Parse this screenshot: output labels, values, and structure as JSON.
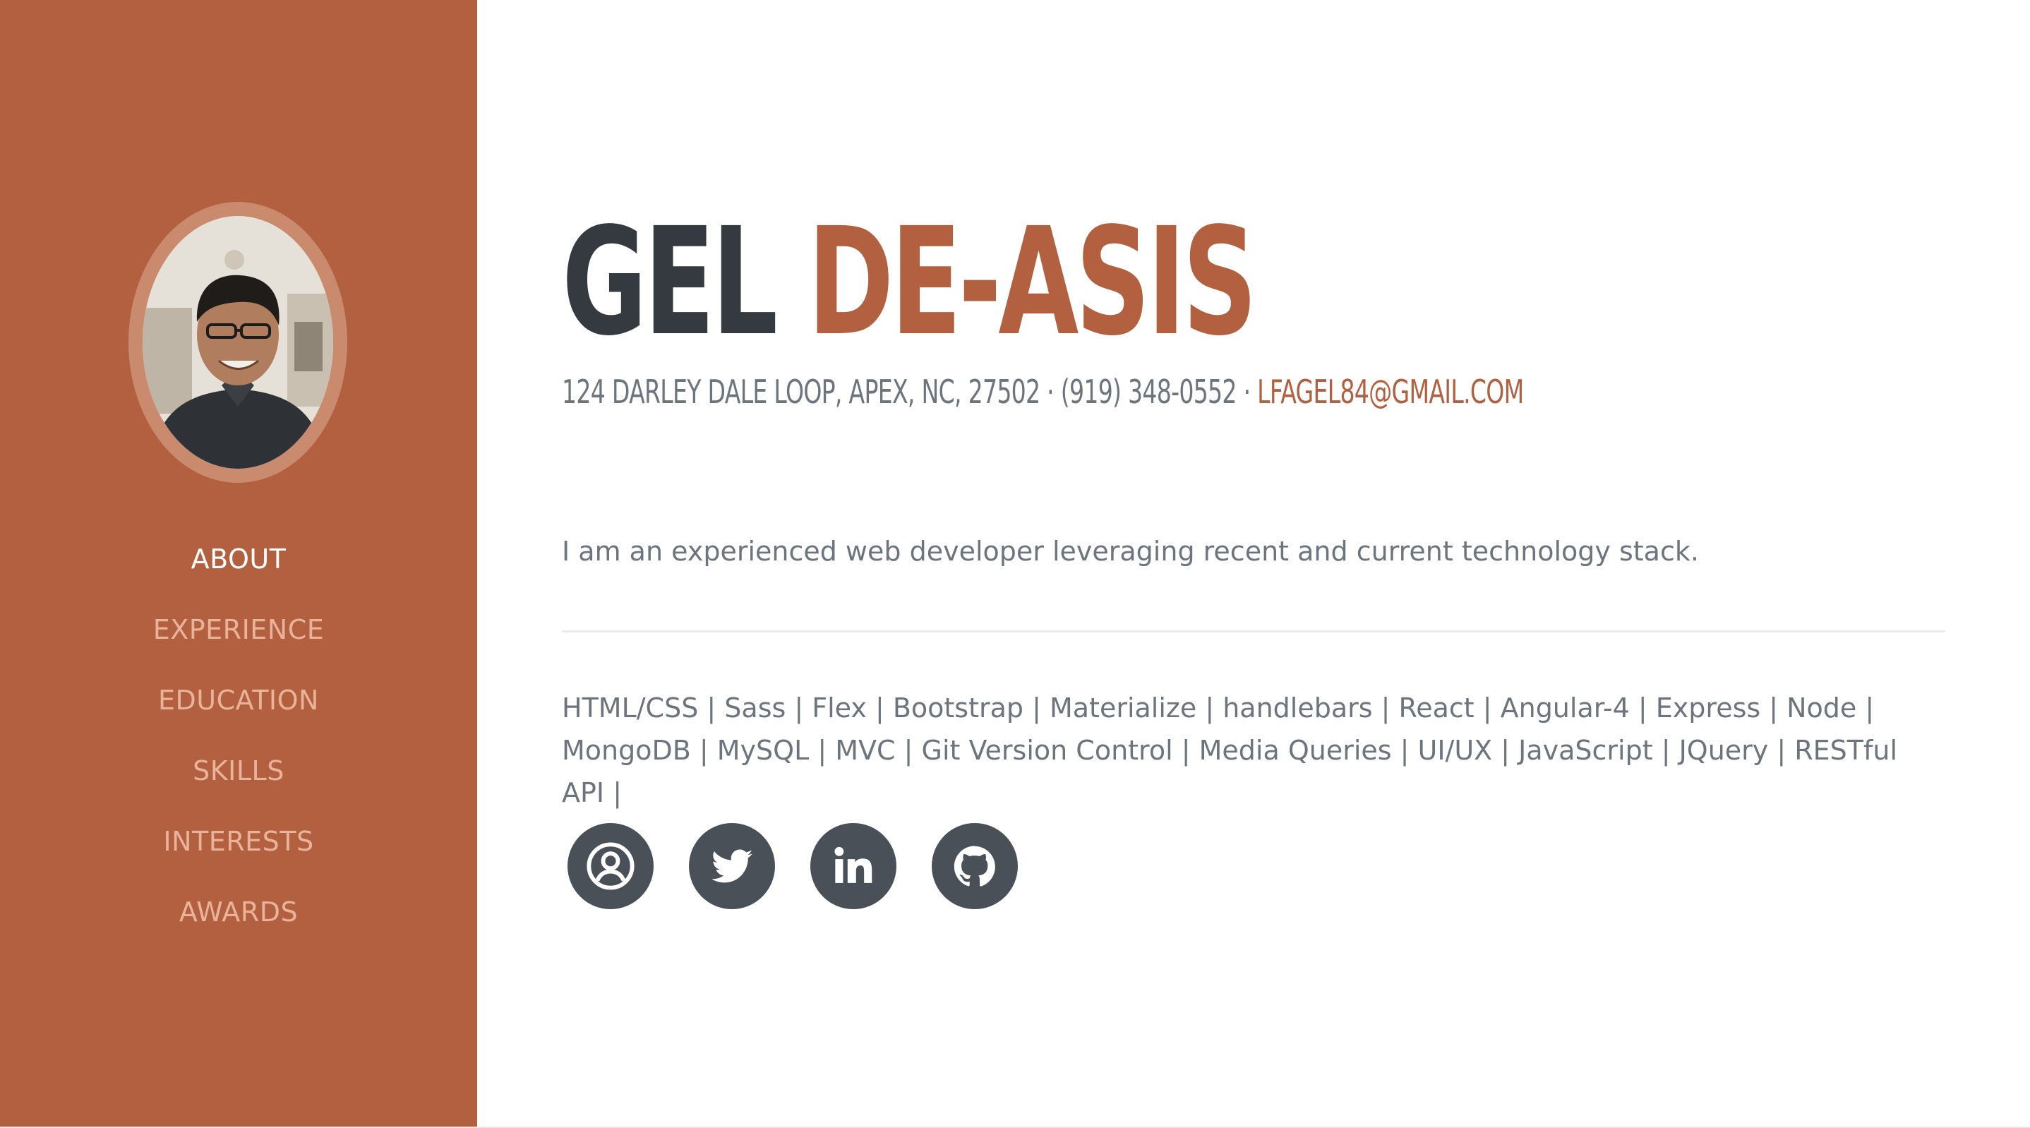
{
  "sidebar": {
    "avatar_alt": "profile photo",
    "nav": [
      {
        "label": "ABOUT",
        "active": true
      },
      {
        "label": "EXPERIENCE",
        "active": false
      },
      {
        "label": "EDUCATION",
        "active": false
      },
      {
        "label": "SKILLS",
        "active": false
      },
      {
        "label": "INTERESTS",
        "active": false
      },
      {
        "label": "AWARDS",
        "active": false
      }
    ]
  },
  "about": {
    "first_name": "GEL",
    "last_name": "DE-ASIS",
    "address_phone": "124 DARLEY DALE LOOP, APEX, NC, 27502 · (919) 348-0552 · ",
    "email": "LFAGEL84@GMAIL.COM",
    "lead": "I am an experienced web developer leveraging recent and current technology stack.",
    "skills": "HTML/CSS | Sass | Flex | Bootstrap | Materialize | handlebars | React | Angular-4 | Express | Node | MongoDB | MySQL | MVC | Git Version Control | Media Queries | UI/UX | JavaScript | JQuery | RESTful API |"
  },
  "social": [
    {
      "icon": "user-circle-icon"
    },
    {
      "icon": "twitter-icon"
    },
    {
      "icon": "linkedin-icon"
    },
    {
      "icon": "github-icon"
    }
  ],
  "colors": {
    "primary": "#b2603f",
    "dark": "#343a40",
    "muted": "#6c757d",
    "nav_inactive": "#e8b39a",
    "icon_bg": "#495057"
  }
}
